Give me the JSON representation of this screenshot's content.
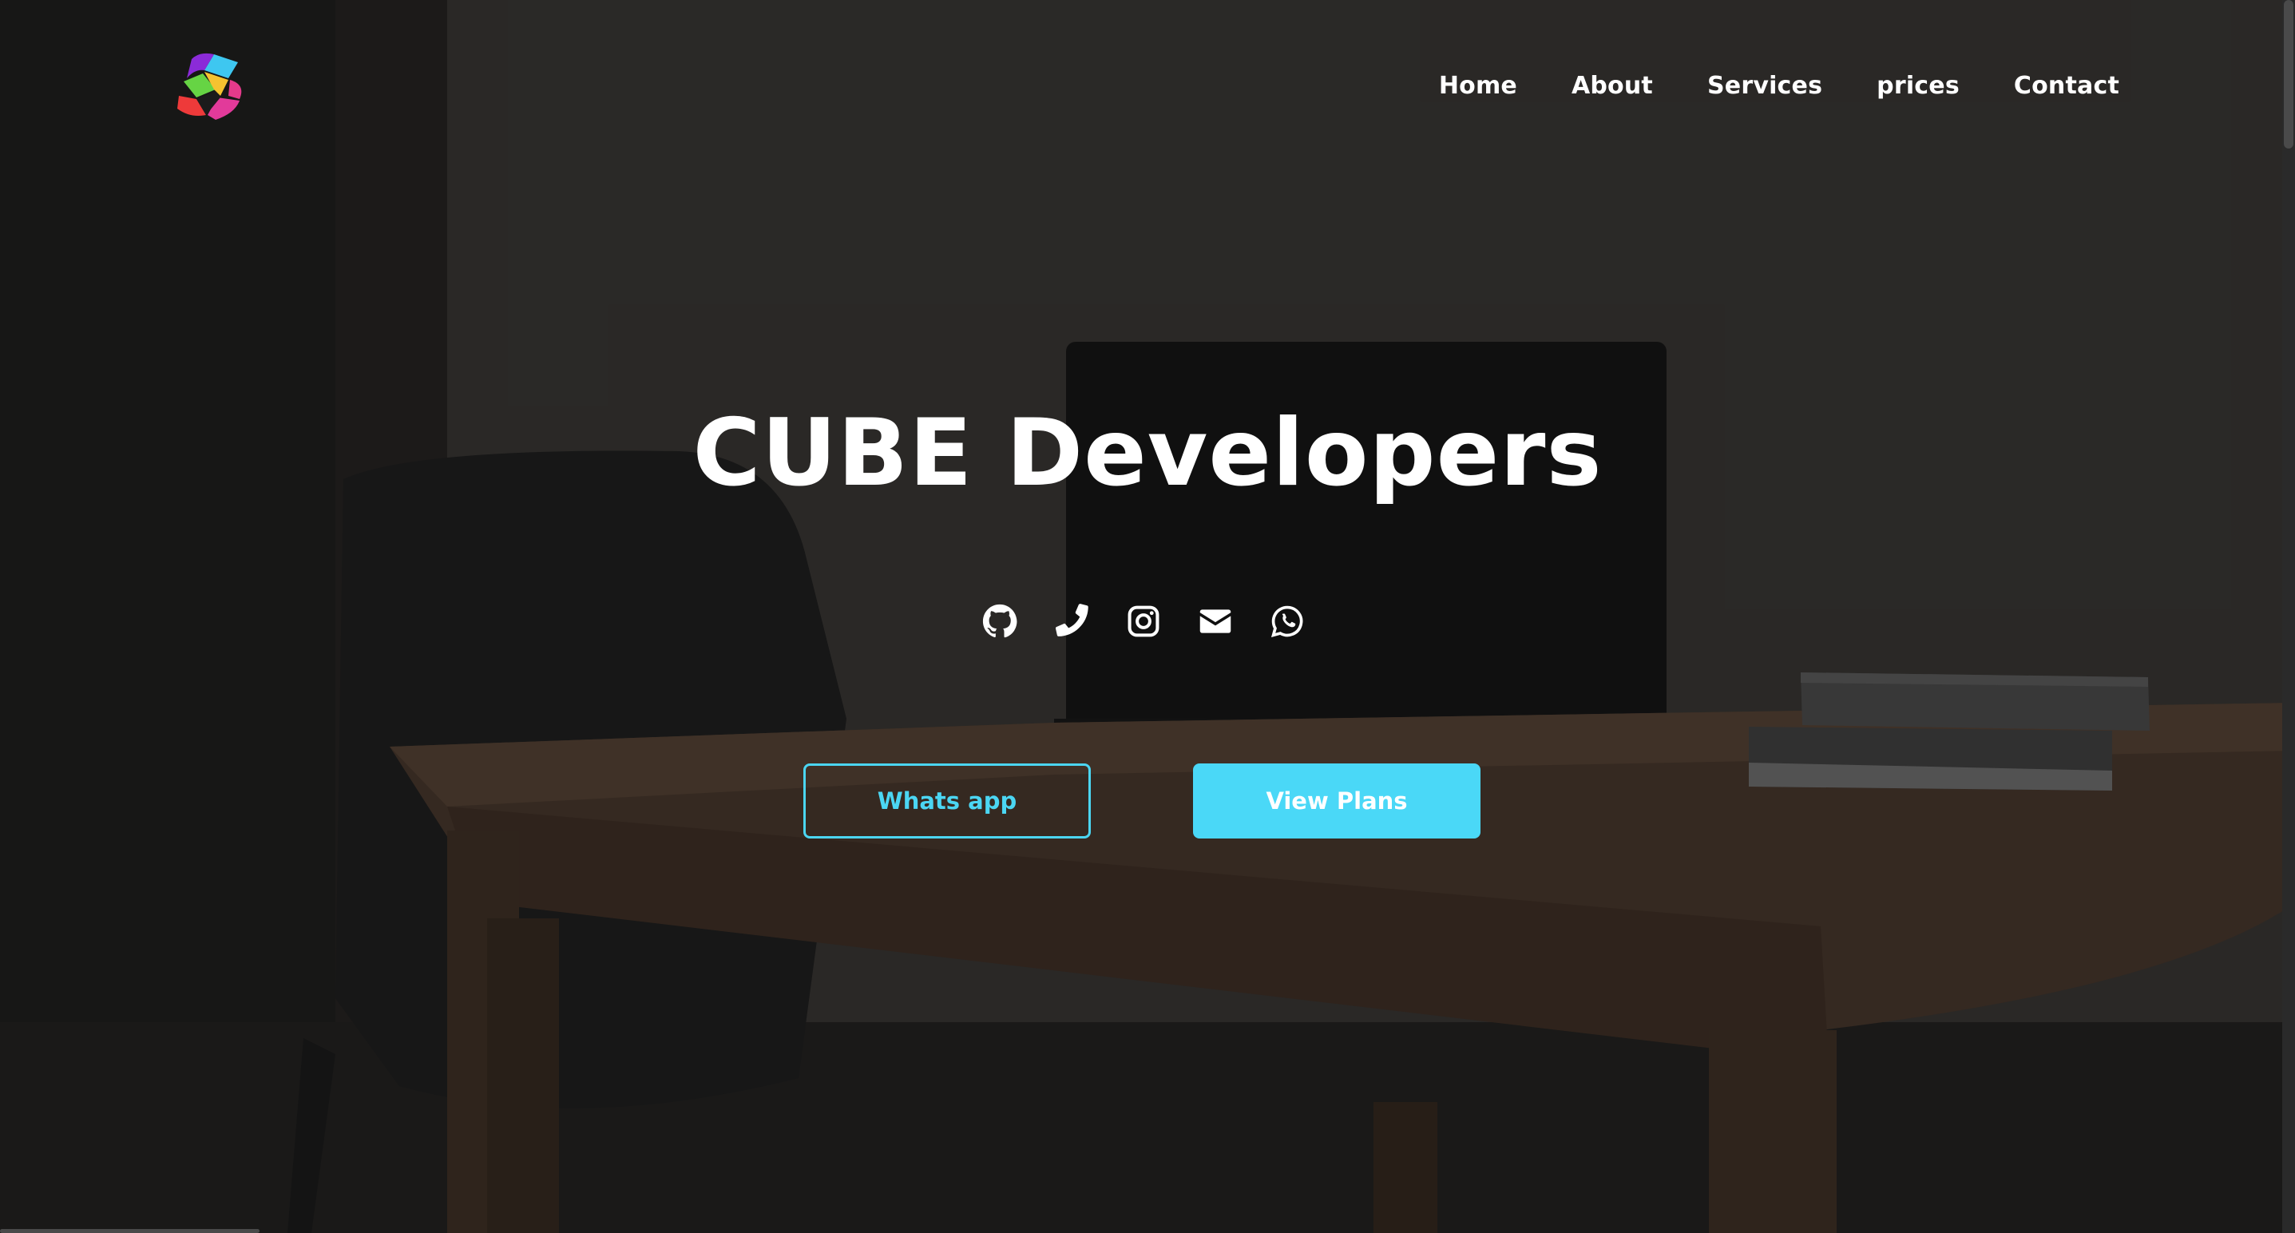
{
  "nav": {
    "logo": "cube-logo",
    "links": [
      {
        "label": "Home"
      },
      {
        "label": "About"
      },
      {
        "label": "Services"
      },
      {
        "label": "prices"
      },
      {
        "label": "Contact"
      }
    ]
  },
  "hero": {
    "title": "CUBE Developers",
    "socials": [
      "github-icon",
      "phone-icon",
      "instagram-icon",
      "envelope-icon",
      "whatsapp-icon"
    ],
    "buttons": {
      "whatsapp": "Whats app",
      "plans": "View Plans"
    }
  },
  "colors": {
    "accent": "#4ad8f7",
    "text": "#ffffff",
    "background": "#2b2927"
  }
}
